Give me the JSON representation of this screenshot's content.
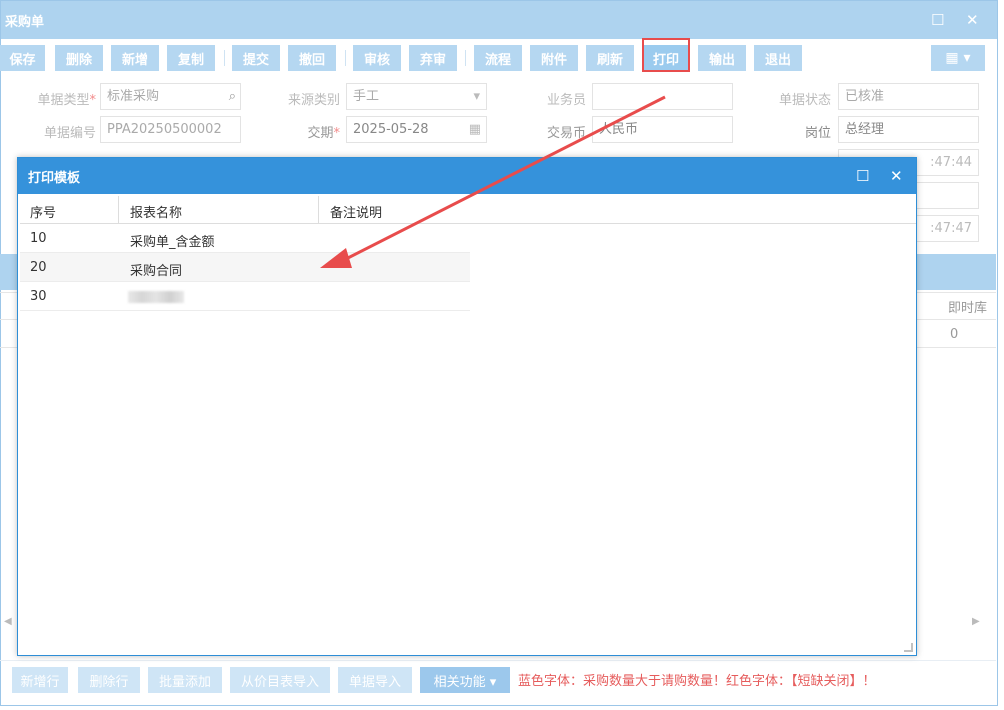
{
  "window": {
    "title": "采购单"
  },
  "toolbar": {
    "buttons": [
      "保存",
      "删除",
      "新增",
      "复制",
      "提交",
      "撤回",
      "审核",
      "弃审",
      "流程",
      "附件",
      "刷新",
      "打印",
      "输出",
      "退出"
    ]
  },
  "form": {
    "doc_type_label": "单据类型",
    "doc_type_value": "标准采购",
    "source_type_label": "来源类别",
    "source_type_value": "手工",
    "salesperson_label": "业务员",
    "salesperson_value": "",
    "doc_status_label": "单据状态",
    "doc_status_value": "已核准",
    "doc_no_label": "单据编号",
    "doc_no_value": "PPA20250500002",
    "delivery_label": "交期",
    "delivery_value": "2025-05-28",
    "currency_label": "交易币",
    "currency_value": "人民币",
    "position_label": "岗位",
    "position_value": "总经理",
    "time_partial_1": ":47:44",
    "time_partial_2": ":47:47"
  },
  "grid": {
    "col_stock": "即时库",
    "row_value": "0"
  },
  "bottom": {
    "buttons": [
      "新增行",
      "删除行",
      "批量添加",
      "从价目表导入",
      "单据导入"
    ],
    "related": "相关功能 ▾",
    "hint": "蓝色字体：采购数量大于请购数量！红色字体：【短缺关闭】！"
  },
  "modal": {
    "title": "打印模板",
    "columns": [
      "序号",
      "报表名称",
      "备注说明"
    ],
    "rows": [
      {
        "no": "10",
        "name": "采购单_含金额",
        "note": ""
      },
      {
        "no": "20",
        "name": "采购合同",
        "note": ""
      },
      {
        "no": "30",
        "name": "",
        "note": ""
      }
    ]
  },
  "colors": {
    "title_bar": "#aed3ef",
    "modal_title": "#3592db",
    "highlight": "#e84c4c",
    "hint": "#e65c5c"
  }
}
